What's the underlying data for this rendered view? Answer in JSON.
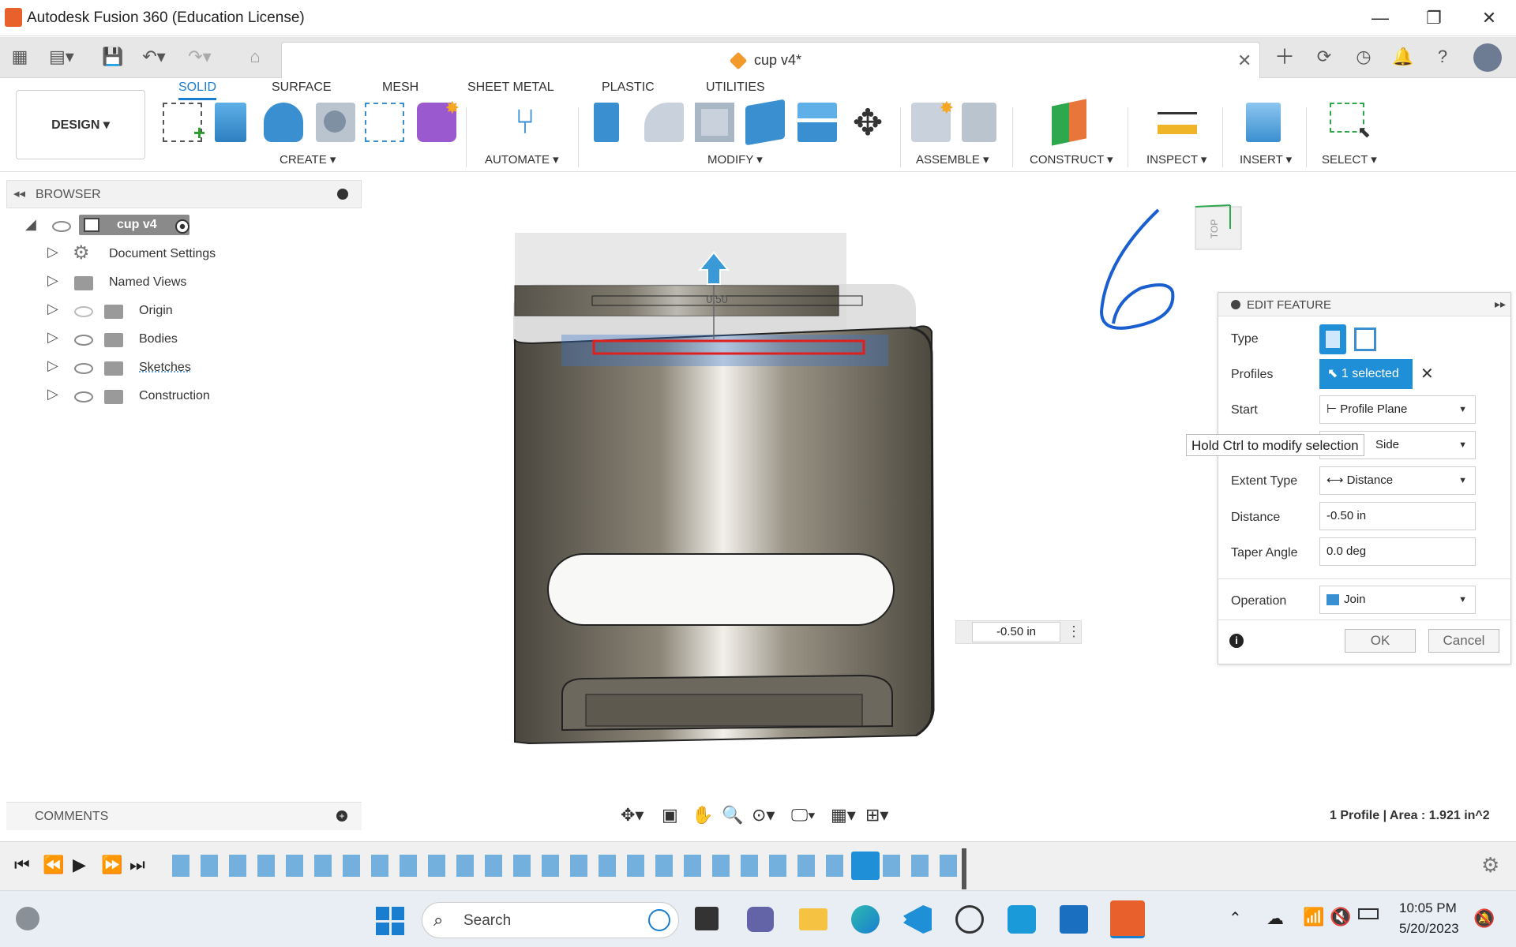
{
  "window": {
    "title": "Autodesk Fusion 360 (Education License)"
  },
  "document": {
    "tab_name": "cup v4*"
  },
  "ribbon": {
    "workspace": "DESIGN",
    "tabs": [
      "SOLID",
      "SURFACE",
      "MESH",
      "SHEET METAL",
      "PLASTIC",
      "UTILITIES"
    ],
    "groups": [
      "CREATE",
      "AUTOMATE",
      "MODIFY",
      "ASSEMBLE",
      "CONSTRUCT",
      "INSPECT",
      "INSERT",
      "SELECT"
    ]
  },
  "browser": {
    "title": "BROWSER",
    "root": "cup v4",
    "items": [
      "Document Settings",
      "Named Views",
      "Origin",
      "Bodies",
      "Sketches",
      "Construction"
    ]
  },
  "viewcube": {
    "face": "TOP"
  },
  "canvas": {
    "annotation": "6",
    "dimension_value": "-0.50 in",
    "arrow_label": "0.50"
  },
  "edit_feature": {
    "title": "EDIT FEATURE",
    "type_label": "Type",
    "profiles_label": "Profiles",
    "profiles_value": "1 selected",
    "start_label": "Start",
    "start_value": "Profile Plane",
    "direction_value": "Side",
    "tooltip": "Hold Ctrl to modify selection",
    "extent_label": "Extent Type",
    "extent_value": "Distance",
    "distance_label": "Distance",
    "distance_value": "-0.50 in",
    "taper_label": "Taper Angle",
    "taper_value": "0.0 deg",
    "operation_label": "Operation",
    "operation_value": "Join",
    "ok": "OK",
    "cancel": "Cancel"
  },
  "comments": {
    "title": "COMMENTS"
  },
  "status": {
    "text": "1 Profile | Area : 1.921 in^2"
  },
  "taskbar": {
    "search_placeholder": "Search",
    "time": "10:05 PM",
    "date": "5/20/2023"
  },
  "colors": {
    "accent": "#1a7ed0",
    "selected_btn": "#1f8fd8",
    "body": "#6b6558"
  }
}
